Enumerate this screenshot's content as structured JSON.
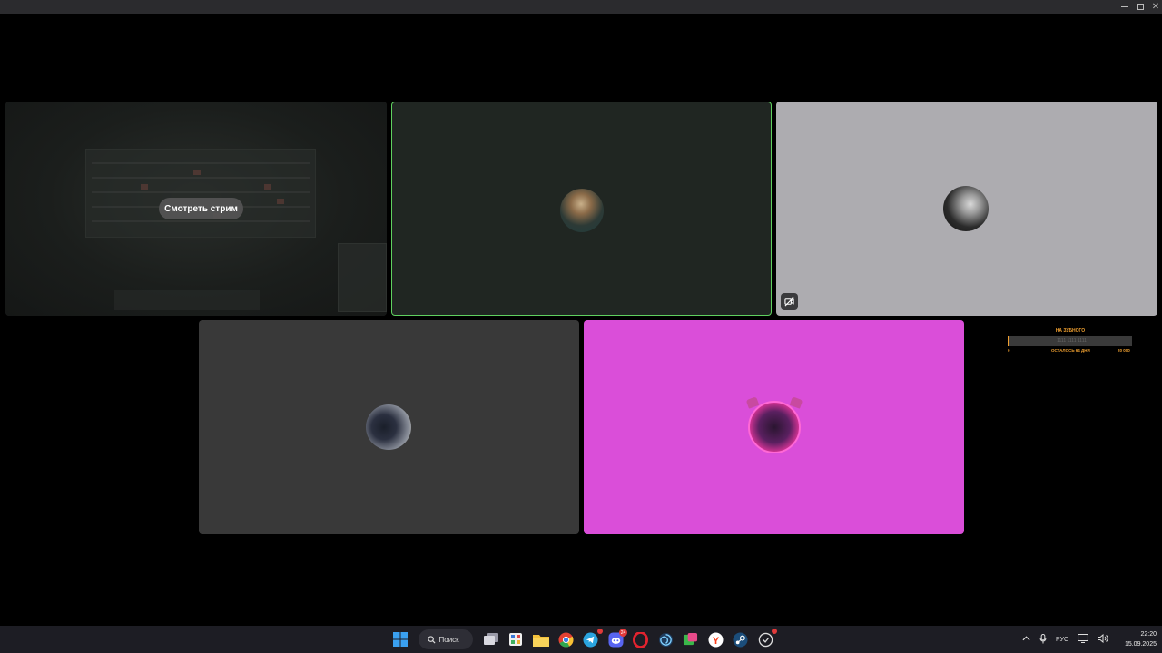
{
  "window": {
    "controls": [
      "minimize",
      "maximize",
      "close"
    ]
  },
  "tiles": [
    {
      "id": "stream",
      "watch_label": "Смотреть стрим"
    },
    {
      "id": "participant-2",
      "speaking": true
    },
    {
      "id": "participant-3",
      "camera_off": true
    },
    {
      "id": "participant-4"
    },
    {
      "id": "participant-5"
    }
  ],
  "widget": {
    "title": "НА ЗУБНОГО",
    "bar_text": "1111 1111 1111",
    "progress_fraction": 0.0,
    "min_label": "0",
    "remaining_label": "ОСТАЛОСЬ 64 ДНЯ",
    "goal_label": "20 000"
  },
  "taskbar": {
    "search_label": "Поиск",
    "apps": [
      {
        "name": "start-icon"
      },
      {
        "name": "search"
      },
      {
        "name": "task-view-icon"
      },
      {
        "name": "widgets-icon"
      },
      {
        "name": "file-explorer-icon"
      },
      {
        "name": "chrome-icon"
      },
      {
        "name": "telegram-icon",
        "badge": ""
      },
      {
        "name": "discord-icon",
        "badge": "24"
      },
      {
        "name": "opera-icon"
      },
      {
        "name": "app-spiral-icon"
      },
      {
        "name": "app-green-icon"
      },
      {
        "name": "yandex-icon"
      },
      {
        "name": "steam-icon"
      },
      {
        "name": "app-active-icon",
        "badge": ""
      }
    ],
    "tray": {
      "language": "РУС",
      "time": "22:20",
      "date": "15.09.2025"
    }
  },
  "colors": {
    "speaking_border": "#5fd15f",
    "tile3_bg": "#adacb0",
    "tile4_bg": "#393939",
    "tile5_bg": "#da4ed9",
    "widget_accent": "#f0a030"
  }
}
